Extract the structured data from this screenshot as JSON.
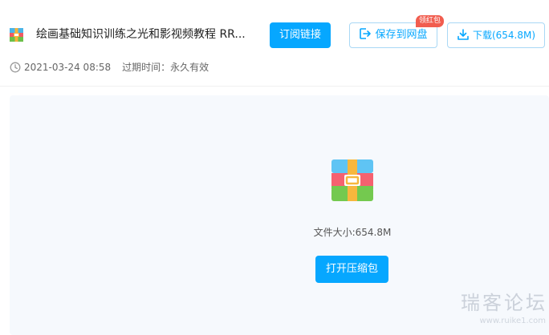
{
  "header": {
    "title": "绘画基础知识训练之光和影视频教程 RR...",
    "subscribe_label": "订阅链接",
    "save_label": "保存到网盘",
    "save_badge": "领红包",
    "download_label": "下载(654.8M)",
    "date": "2021-03-24 08:58",
    "expire_label": "过期时间：",
    "expire_value": "永久有效"
  },
  "preview": {
    "file_size_label": "文件大小:",
    "file_size_value": "654.8M",
    "open_label": "打开压缩包"
  },
  "watermark": {
    "text": "瑞客论坛",
    "sub": "www.ruike1.com"
  },
  "colors": {
    "accent": "#06a7ff",
    "badge": "#f15d4f",
    "panel_bg": "#f6f9fd"
  },
  "icons": {
    "file": "rar-archive-icon",
    "save": "save-to-cloud-icon",
    "download": "download-icon",
    "clock": "clock-icon",
    "archive": "archive-icon"
  }
}
